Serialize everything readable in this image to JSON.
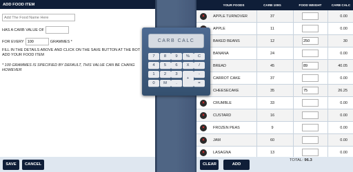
{
  "left_panel": {
    "header": "ADD FOOD ITEM",
    "name_placeholder": "Add The Food Name Here",
    "carb_label": "HAS A CARB VALUE OF",
    "carb_value": "",
    "every_label": "FOR EVERY",
    "every_value": "100",
    "grammes_label": "GRAMMES *",
    "instruction_line1": "FILL IN THE DETAILS ABOVE AND CLICK ON THE SAVE BUTTON AT THE BOT",
    "instruction_line2": "ADD YOUR FOOD ITEM",
    "note_line1": "* 100 GRAMMES IS SPECIFIED BY DEFAULT, THIS VALUE CAN BE CHANG",
    "note_line2": "HOWEVER",
    "save_label": "SAVE",
    "cancel_label": "CANCEL"
  },
  "calculator": {
    "display": "CARB CALC",
    "keys": [
      "7",
      "8",
      "9",
      "%",
      "C",
      "4",
      "5",
      "6",
      "X",
      "/",
      "1",
      "2",
      "3",
      "+",
      "-",
      "0",
      "M",
      ".",
      "="
    ]
  },
  "table": {
    "columns": [
      "YOUR FOODS",
      "CARB 100G",
      "FOOD WEIGHT",
      "CARB CALC"
    ],
    "delete_icon": "x-icon",
    "rows": [
      {
        "name": "APPLE TURNOVER",
        "carb": "37",
        "weight": "",
        "calc": "0.00"
      },
      {
        "name": "APPLE",
        "carb": "11",
        "weight": "",
        "calc": "0.00"
      },
      {
        "name": "BAKED BEANS",
        "carb": "12",
        "weight": "250",
        "calc": "30"
      },
      {
        "name": "BANANA",
        "carb": "24",
        "weight": "",
        "calc": "0.00"
      },
      {
        "name": "BREAD",
        "carb": "45",
        "weight": "89",
        "calc": "40.05"
      },
      {
        "name": "CARROT CAKE",
        "carb": "37",
        "weight": "",
        "calc": "0.00"
      },
      {
        "name": "CHEESECAKE",
        "carb": "35",
        "weight": "75",
        "calc": "26.25"
      },
      {
        "name": "CRUMBLE",
        "carb": "33",
        "weight": "",
        "calc": "0.00"
      },
      {
        "name": "CUSTARD",
        "carb": "16",
        "weight": "",
        "calc": "0.00"
      },
      {
        "name": "FROZEN PEAS",
        "carb": "9",
        "weight": "",
        "calc": "0.00"
      },
      {
        "name": "JAM",
        "carb": "60",
        "weight": "",
        "calc": "0.00"
      },
      {
        "name": "LASAGNA",
        "carb": "13",
        "weight": "",
        "calc": "0.00"
      }
    ],
    "clear_label": "CLEAR",
    "add_food_label": "ADD FOOD",
    "total_label": "TOTAL:",
    "total_value": "96.3"
  }
}
